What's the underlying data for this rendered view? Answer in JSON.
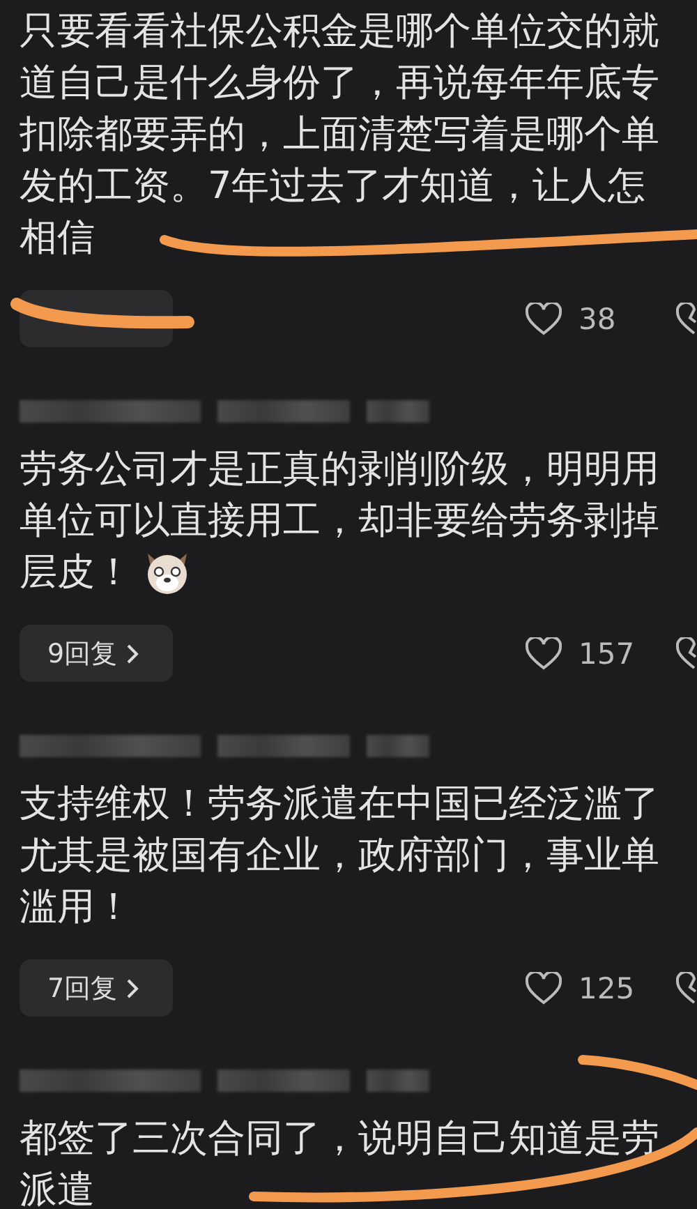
{
  "comments": [
    {
      "lines": [
        "只要看看社保公积金是哪个单位交的就",
        "道自己是什么身份了，再说每年年底专",
        "扣除都要弄的，上面清楚写着是哪个单",
        "发的工资。7年过去了才知道，让人怎",
        "相信"
      ],
      "emoji": false,
      "likes": "38"
    },
    {
      "header": {
        "kind": "blurred"
      },
      "lines": [
        "劳务公司才是正真的剥削阶级，明明用",
        "单位可以直接用工，却非要给劳务剥掉",
        "层皮！"
      ],
      "emoji": true,
      "replies": "9回复",
      "likes": "157"
    },
    {
      "header": {
        "kind": "blurred"
      },
      "lines": [
        "支持维权！劳务派遣在中国已经泛滥了",
        "尤其是被国有企业，政府部门，事业单",
        "滥用！"
      ],
      "emoji": false,
      "replies": "7回复",
      "likes": "125"
    },
    {
      "header": {
        "kind": "blurred"
      },
      "lines": [
        "都签了三次合同了，说明自己知道是劳",
        "派遣"
      ],
      "emoji": false
    }
  ]
}
